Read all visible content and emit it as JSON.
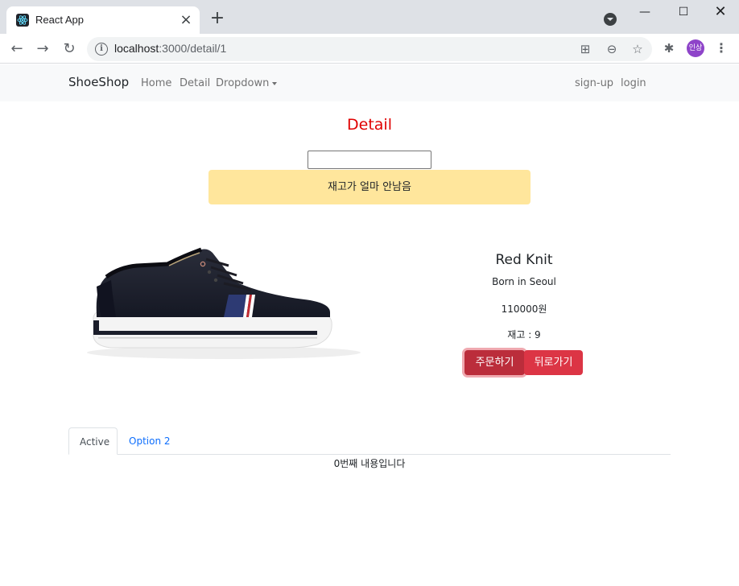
{
  "browser": {
    "tab_title": "React App",
    "url_host": "localhost",
    "url_path": ":3000/detail/1",
    "profile_initials": "인상"
  },
  "navbar": {
    "brand": "ShoeShop",
    "links": [
      "Home",
      "Detail",
      "Dropdown"
    ],
    "right_links": [
      "sign-up",
      "login"
    ]
  },
  "detail": {
    "title": "Detail",
    "input_value": "",
    "alert_text": "재고가 얼마 안남음"
  },
  "product": {
    "name": "Red Knit",
    "description": "Born in Seoul",
    "price": "110000원",
    "stock": "재고 : 9",
    "order_button": "주문하기",
    "back_button": "뒤로가기"
  },
  "tabs": {
    "items": [
      "Active",
      "Option 2"
    ],
    "content": "0번째 내용입니다"
  },
  "colors": {
    "title_red": "#e00000",
    "alert_bg": "#ffe69c",
    "button_red": "#dc3545",
    "link_blue": "#0d6efd"
  }
}
